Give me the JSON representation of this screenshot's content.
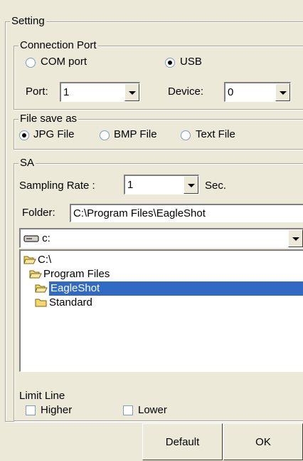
{
  "setting": {
    "title": "Setting",
    "connection": {
      "title": "Connection Port",
      "com_label": "COM port",
      "com_selected": false,
      "usb_label": "USB",
      "usb_selected": true,
      "port_label": "Port:",
      "port_value": "1",
      "device_label": "Device:",
      "device_value": "0"
    },
    "file_save": {
      "title": "File save as",
      "options": [
        {
          "label": "JPG File",
          "selected": true
        },
        {
          "label": "BMP File",
          "selected": false
        },
        {
          "label": "Text File",
          "selected": false
        }
      ]
    },
    "sa": {
      "title": "SA",
      "sampling_label": "Sampling Rate :",
      "sampling_value": "1",
      "sampling_unit": "Sec.",
      "folder_label": "Folder:",
      "folder_value": "C:\\Program Files\\EagleShot",
      "drive_value": "c:",
      "tree": [
        {
          "label": "C:\\",
          "open": true,
          "selected": false
        },
        {
          "label": "Program Files",
          "open": true,
          "selected": false
        },
        {
          "label": "EagleShot",
          "open": true,
          "selected": true
        },
        {
          "label": "Standard",
          "open": false,
          "selected": false
        }
      ],
      "limit_title": "Limit Line",
      "higher_label": "Higher",
      "higher_checked": false,
      "lower_label": "Lower",
      "lower_checked": false
    }
  },
  "buttons": {
    "default_label": "Default",
    "ok_label": "OK"
  },
  "colors": {
    "background": "#ece9d8",
    "selection": "#316ac5",
    "folder": "#f5d86b"
  }
}
